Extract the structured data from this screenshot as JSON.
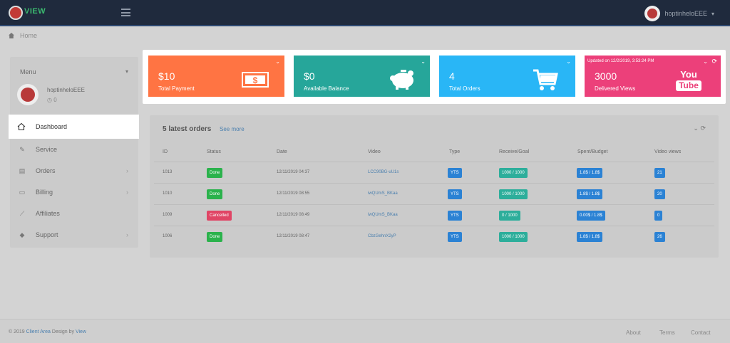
{
  "app": {
    "logo_text": "VIEW"
  },
  "topbar": {
    "username": "hoptinheloEEE"
  },
  "breadcrumb": {
    "home_label": "Home"
  },
  "sidebar": {
    "menu_label": "Menu",
    "username": "hoptinheloEEE",
    "user_sub": "0",
    "items": [
      {
        "label": "Dashboard",
        "icon": "home-icon",
        "active": true
      },
      {
        "label": "Service",
        "icon": "wrench-icon"
      },
      {
        "label": "Orders",
        "icon": "cart-icon"
      },
      {
        "label": "Billing",
        "icon": "card-icon"
      },
      {
        "label": "Affiliates",
        "icon": "link-icon"
      },
      {
        "label": "Support",
        "icon": "ticket-icon"
      }
    ]
  },
  "stats": [
    {
      "value": "$10",
      "label": "Total Payment",
      "color": "#ff7443",
      "icon": "money-icon"
    },
    {
      "value": "$0",
      "label": "Available Balance",
      "color": "#26a69a",
      "icon": "piggy-bank-icon"
    },
    {
      "value": "4",
      "label": "Total Orders",
      "color": "#29b6f6",
      "icon": "cart-icon"
    },
    {
      "value": "3000",
      "label": "Delivered Views",
      "color": "#ec407a",
      "icon": "youtube-icon",
      "updated": "Updated on 12/2/2019, 3:53:24 PM"
    }
  ],
  "youtube_logo": {
    "top": "You",
    "bottom": "Tube"
  },
  "orders": {
    "title": "5 latest orders",
    "see_more": "See more",
    "columns": [
      "ID",
      "Status",
      "Date",
      "Video",
      "Type",
      "Receive/Goal",
      "Spent/Budget",
      "Video views"
    ],
    "rows": [
      {
        "id": "1013",
        "status": "Done",
        "date": "12/11/2019 04:37",
        "video": "LCC90BG-uU1s",
        "type": "YTS",
        "goal": "1000 / 1000",
        "budget": "1.8$ / 1.8$",
        "views": "21"
      },
      {
        "id": "1010",
        "status": "Done",
        "date": "12/11/2019 08:55",
        "video": "iwQUmS_BKaa",
        "type": "YTS",
        "goal": "1000 / 1000",
        "budget": "1.8$ / 1.8$",
        "views": "20"
      },
      {
        "id": "1009",
        "status": "Cancelled",
        "date": "12/11/2019 08:49",
        "video": "iwQUmS_BKaa",
        "type": "YTS",
        "goal": "0 / 1000",
        "budget": "0.00$ / 1.8$",
        "views": "0"
      },
      {
        "id": "1006",
        "status": "Done",
        "date": "12/11/2019 08:47",
        "video": "CbzGehnX2yP",
        "type": "YTS",
        "goal": "1000 / 1000",
        "budget": "1.8$ / 1.8$",
        "views": "26"
      }
    ]
  },
  "footer": {
    "copyright": "© 2019",
    "brand": "Client Area",
    "design_by": "Design by",
    "designer": "View",
    "links": [
      "About",
      "Terms",
      "Contact"
    ]
  },
  "colors": {
    "done": "#2bb24c",
    "cancelled": "#e04565",
    "blue_badge": "#2b82d4",
    "teal_badge": "#2dae9b"
  }
}
